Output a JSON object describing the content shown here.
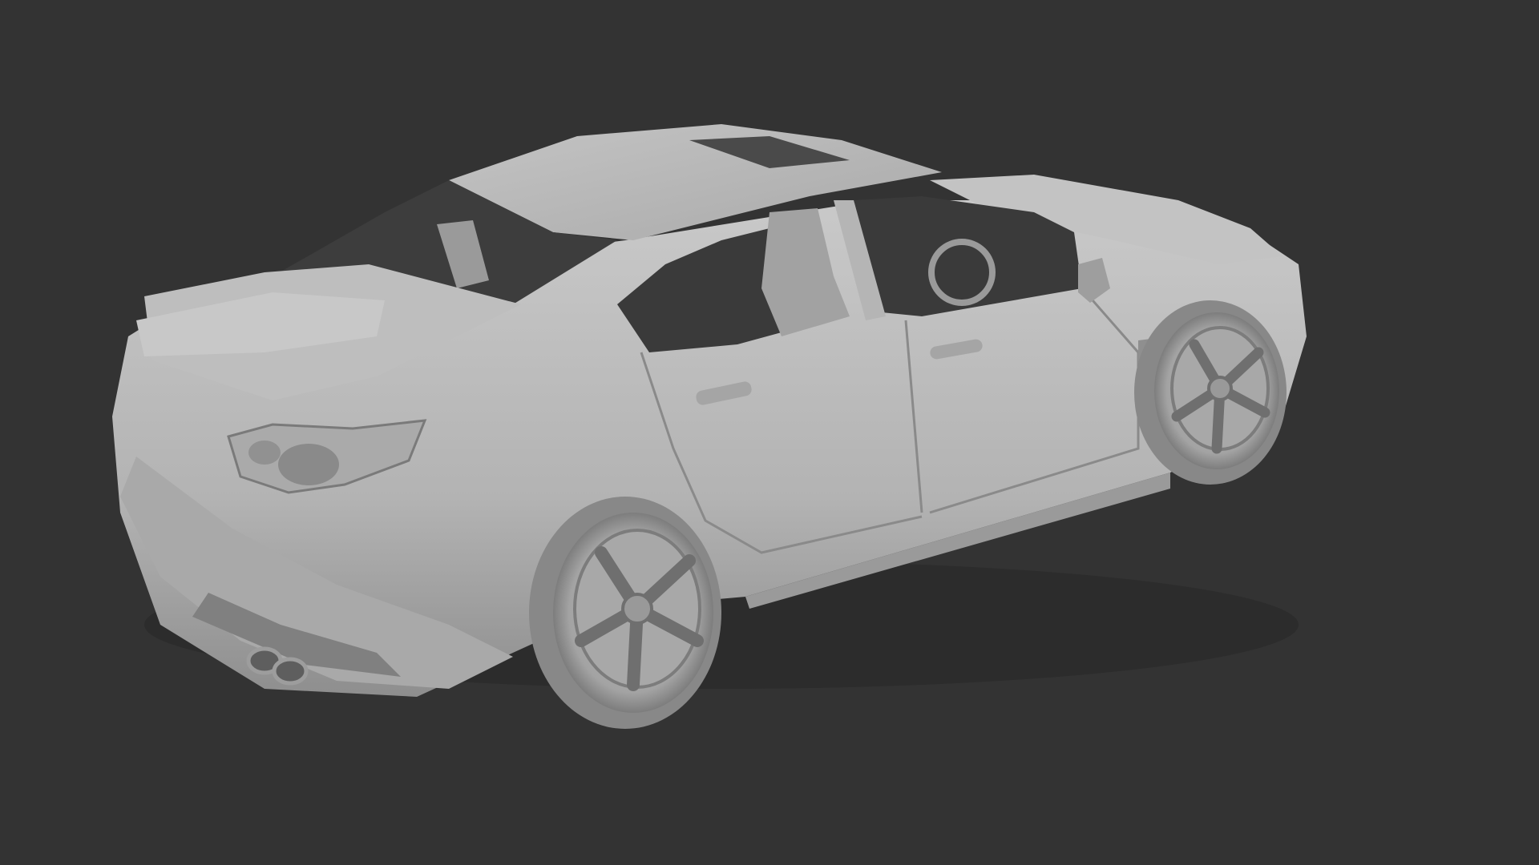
{
  "viewport": {
    "background_color": "#333333",
    "model_color": "#b8b8b8",
    "subject": "car-model-icon"
  }
}
